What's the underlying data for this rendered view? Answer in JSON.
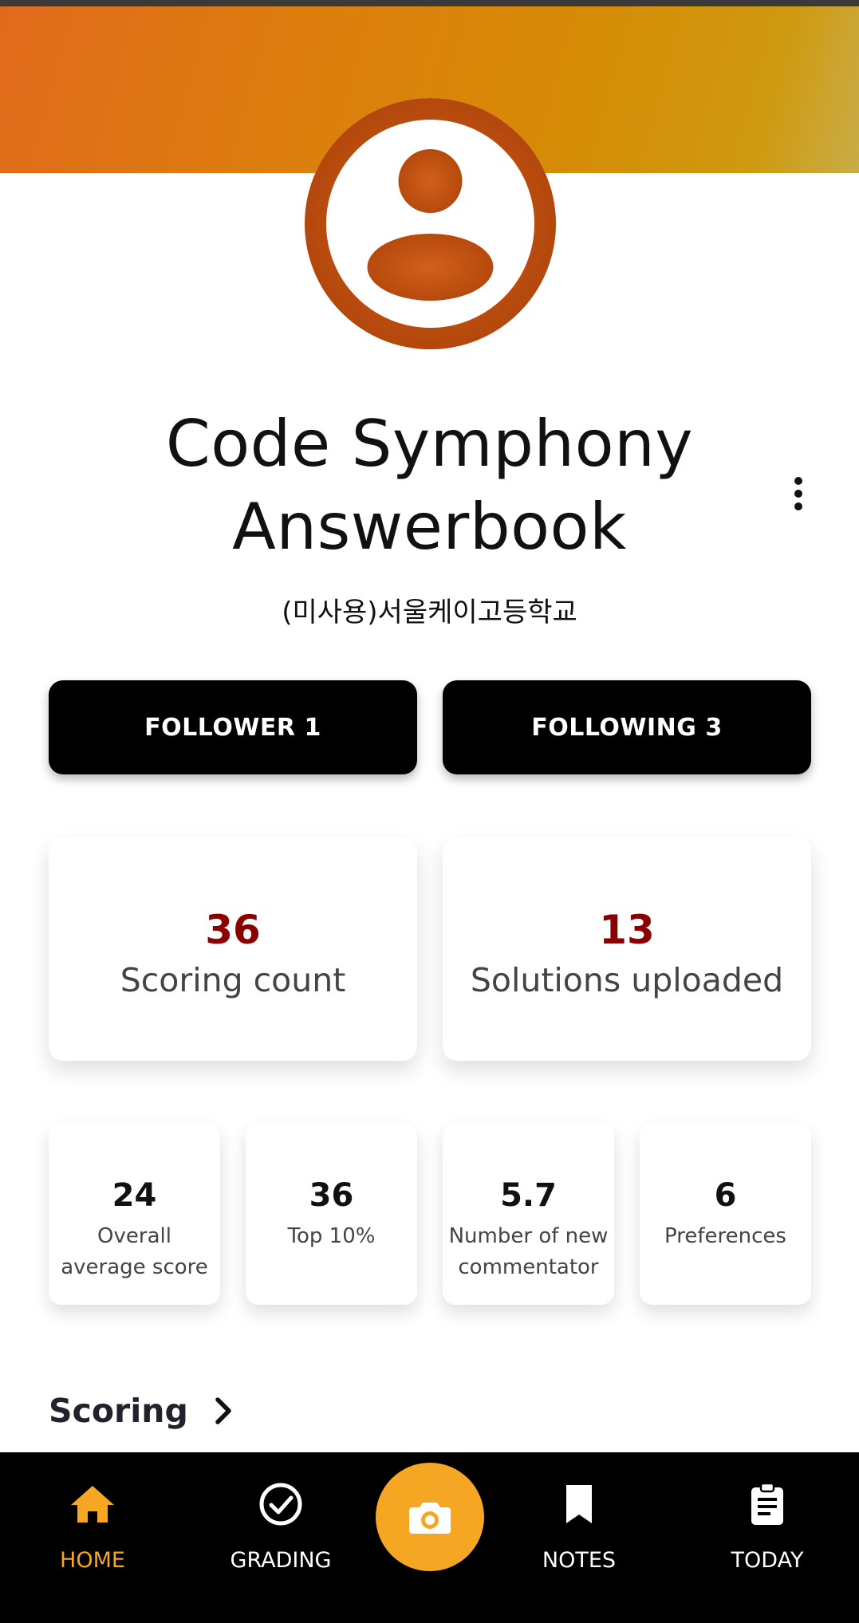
{
  "profile": {
    "title": "Code Symphony Answerbook",
    "school": "(미사용)서울케이고등학교",
    "avatar_icon": "account-circle-icon"
  },
  "colors": {
    "banner_start": "#e06a1b",
    "banner_end": "#c9ac48",
    "avatar": "#c2510f",
    "accent": "#f5a623",
    "stat_number": "#8b0000"
  },
  "follow": {
    "followers_label": "FOLLOWER 1",
    "following_label": "FOLLOWING 3"
  },
  "stats_primary": [
    {
      "value": "36",
      "label": "Scoring count"
    },
    {
      "value": "13",
      "label": "Solutions uploaded"
    }
  ],
  "stats_secondary": [
    {
      "value": "24",
      "label": "Overall average score"
    },
    {
      "value": "36",
      "label": "Top 10%"
    },
    {
      "value": "5.7",
      "label": "Number of new commentator"
    },
    {
      "value": "6",
      "label": "Preferences"
    }
  ],
  "section": {
    "title": "Scoring"
  },
  "nav": {
    "items": [
      {
        "label": "HOME",
        "icon": "home-icon",
        "active": true
      },
      {
        "label": "GRADING",
        "icon": "check-circle-icon",
        "active": false
      },
      {
        "label": "NOTES",
        "icon": "bookmark-icon",
        "active": false
      },
      {
        "label": "TODAY",
        "icon": "clipboard-icon",
        "active": false
      }
    ],
    "camera_icon": "camera-icon"
  }
}
